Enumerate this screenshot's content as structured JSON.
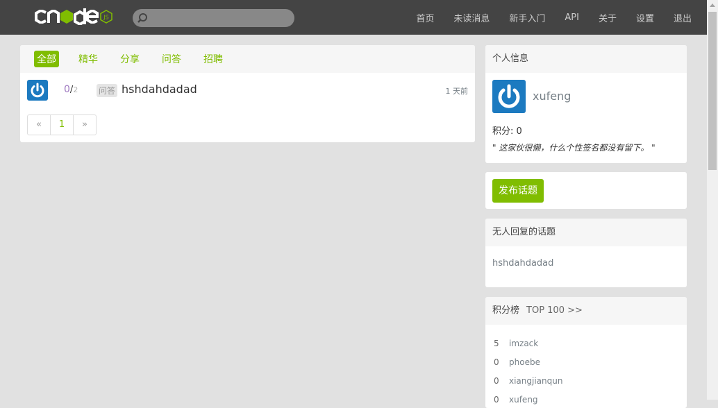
{
  "colors": {
    "navbar": "#444444",
    "brand": "#80bd01",
    "avatar": "#1c7ac0",
    "background": "#e1e1e1"
  },
  "navbar": {
    "logo": "cnode",
    "logo_badge": "JS",
    "search": {
      "placeholder": "",
      "value": "",
      "icon": "search-icon"
    },
    "links": [
      "首页",
      "未读消息",
      "新手入门",
      "API",
      "关于",
      "设置",
      "退出"
    ]
  },
  "main": {
    "tabs": [
      {
        "label": "全部",
        "active": true
      },
      {
        "label": "精华",
        "active": false
      },
      {
        "label": "分享",
        "active": false
      },
      {
        "label": "问答",
        "active": false
      },
      {
        "label": "招聘",
        "active": false
      }
    ],
    "topics": [
      {
        "reply_count": "0",
        "separator": "/",
        "visit_count": "2",
        "tag": "问答",
        "title": "hshdahdadad",
        "time": "1 天前",
        "avatar_icon": "power-icon"
      }
    ],
    "pagination": {
      "prev": "«",
      "current": "1",
      "next": "»"
    }
  },
  "sidebar": {
    "profile": {
      "header": "个人信息",
      "username": "xufeng",
      "score": "积分: 0",
      "signature": "\" 这家伙很懒，什么个性签名都没有留下。 \""
    },
    "publish_label": "发布话题",
    "unreplied": {
      "header": "无人回复的话题",
      "items": [
        "hshdahdadad"
      ]
    },
    "ranking": {
      "header": "积分榜",
      "top_link": "TOP 100 >>",
      "items": [
        {
          "score": "5",
          "name": "imzack"
        },
        {
          "score": "0",
          "name": "phoebe"
        },
        {
          "score": "0",
          "name": "xiangjianqun"
        },
        {
          "score": "0",
          "name": "xufeng"
        }
      ]
    }
  }
}
